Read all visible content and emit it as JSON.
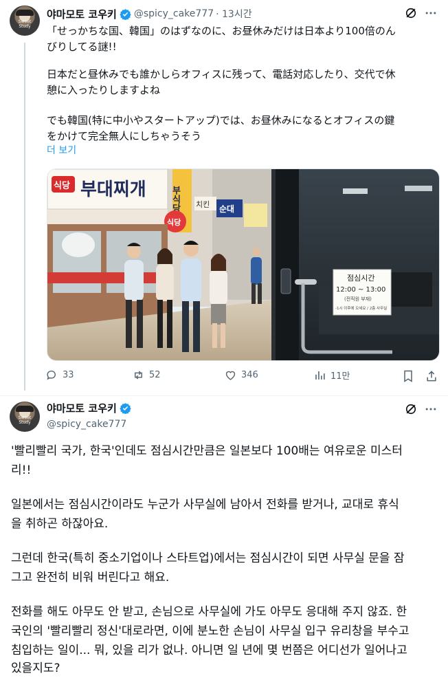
{
  "post1": {
    "author_name": "야마모토 코우키",
    "handle": "@spicy_cake777",
    "time": "· 13시간",
    "lines": [
      "「せっかちな国、韓国」のはずなのに、お昼休みだけは日本より100倍のん",
      "びりしてる謎!!",
      "日本だと昼休みでも誰かしらオフィスに残って、電話対応したり、交代で休",
      "憩に入ったりしますよね",
      "でも韓国(特に中小やスタートアップ)では、お昼休みになるとオフィスの鍵",
      "をかけて完全無人にしちゃうそう"
    ],
    "show_more": "더 보기",
    "image": {
      "sign_main": "부대찌개",
      "sign_small_red": "식당",
      "sign_vertical": "부식당",
      "sign_round": "식당",
      "sign_chicken": "치킨",
      "sign_side": "순대",
      "notice_title": "점심시간",
      "notice_time": "12:00 ~ 13:00",
      "notice_sub": "(전직원 부재)",
      "notice_foot": "-1시 이후에 오세요 / 2층 사무실"
    },
    "actions": {
      "replies": "33",
      "reposts": "52",
      "likes": "346",
      "views": "11만"
    }
  },
  "post2": {
    "author_name": "야마모토 코우키",
    "handle": "@spicy_cake777",
    "lines": [
      "'빨리빨리 국가, 한국'인데도 점심시간만큼은 일본보다 100배는 여유로운 미스터",
      "리!!",
      "일본에서는 점심시간이라도 누군가 사무실에 남아서 전화를 받거나, 교대로 휴식",
      "을 취하곤 하잖아요.",
      "그런데 한국(특히 중소기업이나 스타트업)에서는 점심시간이 되면 사무실 문을 잠",
      "그고 완전히 비워 버린다고 해요.",
      "전화를 해도 아무도 안 받고, 손님으로 사무실에 가도 아무도 응대해 주지 않죠. 한",
      "국인의 '빨리빨리 정신'대로라면, 이에 분노한 손님이 사무실 입구 유리창을 부수고",
      "침입하는 일이... 뭐, 있을 리가 없나. 아니면 일 년에 몇 번쯤은 어디선가 일어나고",
      "있을지도?"
    ]
  },
  "avatar_label": "Sweet Study",
  "colors": {
    "accent": "#1d9bf0",
    "muted": "#536471",
    "text": "#0f1419"
  }
}
